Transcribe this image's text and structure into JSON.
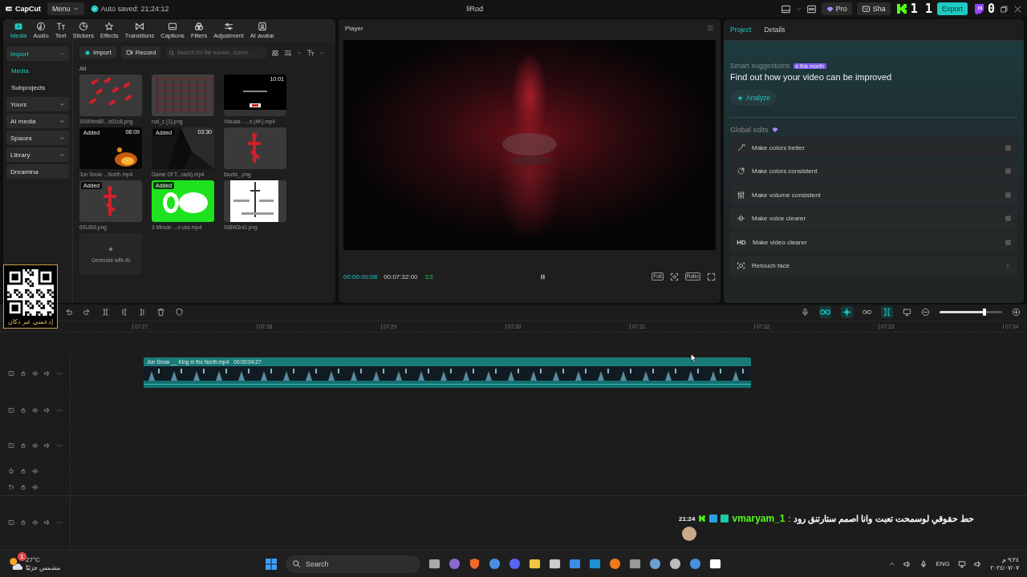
{
  "top_bar": {
    "logo": "CapCut",
    "menu": "Menu",
    "autosave": "Auto saved: 21:24:12",
    "title": "liRod",
    "pro": "Pro",
    "share": "Sha",
    "export": "Export"
  },
  "stream_overlay": {
    "kick_count": "1 1",
    "twitch_count": "0",
    "qr_caption": "إدعمني عبر دكان"
  },
  "toolbar_tabs": [
    {
      "label": "Media",
      "selected": true
    },
    {
      "label": "Audio",
      "selected": false
    },
    {
      "label": "Text",
      "selected": false
    },
    {
      "label": "Stickers",
      "selected": false
    },
    {
      "label": "Effects",
      "selected": false
    },
    {
      "label": "Transitions",
      "selected": false
    },
    {
      "label": "Captions",
      "selected": false
    },
    {
      "label": "Filters",
      "selected": false
    },
    {
      "label": "Adjustment",
      "selected": false
    },
    {
      "label": "AI avatar",
      "selected": false
    }
  ],
  "sidebar": {
    "items": [
      {
        "label": "Import",
        "kind": "group",
        "expanded": true,
        "selected": true
      },
      {
        "label": "Media",
        "kind": "sub",
        "selected": true
      },
      {
        "label": "Subprojects",
        "kind": "sub",
        "selected": false
      },
      {
        "label": "Yours",
        "kind": "group",
        "expanded": false,
        "selected": false
      },
      {
        "label": "AI media",
        "kind": "group",
        "expanded": false,
        "selected": false
      },
      {
        "label": "Spaces",
        "kind": "group",
        "expanded": false,
        "selected": false
      },
      {
        "label": "Library",
        "kind": "group",
        "expanded": false,
        "selected": false
      },
      {
        "label": "Dreamina",
        "kind": "plain",
        "selected": false
      }
    ]
  },
  "media": {
    "import": "Import",
    "record": "Record",
    "search": {
      "placeholder": "Search for file names, scene..."
    },
    "section": "All",
    "items": [
      {
        "name": "3090feb80...b01c8.png",
        "kind": "picture"
      },
      {
        "name": "rod_c (1).png",
        "kind": "picture"
      },
      {
        "name": "Visuals - ...s (4K).mp4",
        "duration": "10:01",
        "kind": "picture"
      },
      {
        "name": "Jon Snow ...North.mp4",
        "badge": "Added",
        "duration": "08:09",
        "kind": "picture"
      },
      {
        "name": "Game Of T...rack).mp4",
        "badge": "Added",
        "duration": "03:30",
        "kind": "picture"
      },
      {
        "name": "6subs_.png",
        "kind": "picture"
      },
      {
        "name": "6SUBS.png",
        "badge": "Added",
        "kind": "picture"
      },
      {
        "name": "3 Minute ...o use.mp4",
        "badge": "Added",
        "kind": "picture"
      },
      {
        "name": "SIBW3nG.png",
        "kind": "picture"
      }
    ],
    "generate": "Generate with AI"
  },
  "player": {
    "title": "Player",
    "current_time": "00:00:00:08",
    "total_time": "00:07:32:00",
    "playing": true,
    "full": "Full",
    "ratio": "Ratio"
  },
  "project_panel": {
    "tabs": [
      {
        "label": "Project",
        "selected": true
      },
      {
        "label": "Details",
        "selected": false
      }
    ],
    "smart_label": "Smart suggestions",
    "promo_badge": "e this month",
    "headline": "Find out how your video can be improved",
    "analyze": "Analyze",
    "global_label": "Global edits",
    "edits": [
      {
        "label": "Make colors better",
        "kind": "toggle",
        "on": false
      },
      {
        "label": "Make colors consistent",
        "kind": "toggle",
        "on": false
      },
      {
        "label": "Make volume consistent",
        "kind": "toggle",
        "on": false
      },
      {
        "label": "Make voice clearer",
        "kind": "toggle",
        "on": false
      },
      {
        "label": "Make video clearer",
        "kind": "toggle",
        "on": false,
        "icon_text": "HD"
      },
      {
        "label": "Retouch face",
        "kind": "link"
      }
    ]
  },
  "timeline": {
    "zoom": {
      "level": 0.72
    },
    "ruler": [
      "07:27",
      "07:28",
      "07:29",
      "07:30",
      "07:31",
      "07:32",
      "07:33",
      "07:34"
    ],
    "tracks": [
      {
        "kind": "video",
        "clips": [
          {
            "name": "Jon Snow __ King in the North.mp4",
            "duration": "00:00:04:27"
          }
        ]
      },
      {
        "kind": "video"
      },
      {
        "kind": "video"
      },
      {
        "kind": "effect"
      },
      {
        "kind": "text"
      },
      {
        "kind": "main"
      }
    ]
  },
  "chat": {
    "time": "21:24",
    "user": "vmaryam_1",
    "separator": ":",
    "message": "حط حقوقي لوسمحت تعبت وانا اصمم ستارتنق رود"
  },
  "taskbar": {
    "weather": {
      "temp": "27°C",
      "condition": "مشمس جزئيًا",
      "badge": "1"
    },
    "search": "Search",
    "language": "ENG",
    "time": "٩:٢٤ م",
    "date": "٢٠٢٤/٠٧/٠٧"
  }
}
